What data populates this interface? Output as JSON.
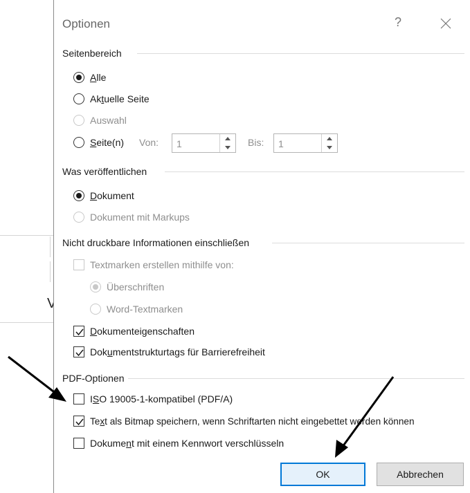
{
  "dialog": {
    "title": "Optionen",
    "help": "?",
    "close_icon": "close-icon"
  },
  "page_range": {
    "label": "Seitenbereich",
    "all": {
      "pre": "",
      "u": "A",
      "post": "lle",
      "selected": true
    },
    "current": {
      "pre": "Ak",
      "u": "t",
      "post": "uelle Seite",
      "selected": false
    },
    "selection": {
      "label": "Auswahl",
      "enabled": false
    },
    "pages": {
      "pre": "",
      "u": "S",
      "post": "eite(n)",
      "selected": false
    },
    "from_label": "Von:",
    "from_value": "1",
    "to_label": "Bis:",
    "to_value": "1"
  },
  "publish": {
    "label": "Was veröffentlichen",
    "document": {
      "pre": "",
      "u": "D",
      "post": "okument",
      "selected": true
    },
    "document_markup": {
      "label": "Dokument mit Markups",
      "enabled": false
    }
  },
  "nonprint": {
    "label": "Nicht druckbare Informationen einschließen",
    "bookmarks": {
      "label": "Textmarken erstellen mithilfe von:",
      "checked": false,
      "enabled": false
    },
    "headings": {
      "label": "Überschriften",
      "selected": true,
      "enabled": false
    },
    "word_bookmarks": {
      "label": "Word-Textmarken",
      "selected": false,
      "enabled": false
    },
    "doc_props": {
      "pre": "",
      "u": "D",
      "post": "okumenteigenschaften",
      "checked": true
    },
    "struct_tags": {
      "pre": "Dok",
      "u": "u",
      "post": "mentstrukturtags für Barrierefreiheit",
      "checked": true
    }
  },
  "pdf": {
    "label": "PDF-Optionen",
    "iso": {
      "pre": "I",
      "u": "S",
      "post": "O 19005-1-kompatibel (PDF/A)",
      "checked": false
    },
    "bitmap": {
      "pre": "Te",
      "u": "x",
      "post": "t als Bitmap speichern, wenn Schriftarten nicht eingebettet werden können",
      "checked": true
    },
    "encrypt": {
      "pre": "Dokume",
      "u": "n",
      "post": "t mit einem Kennwort verschlüsseln",
      "checked": false
    }
  },
  "buttons": {
    "ok": "OK",
    "cancel": "Abbrechen"
  },
  "background": {
    "chars": [
      "\\",
      "V"
    ]
  }
}
